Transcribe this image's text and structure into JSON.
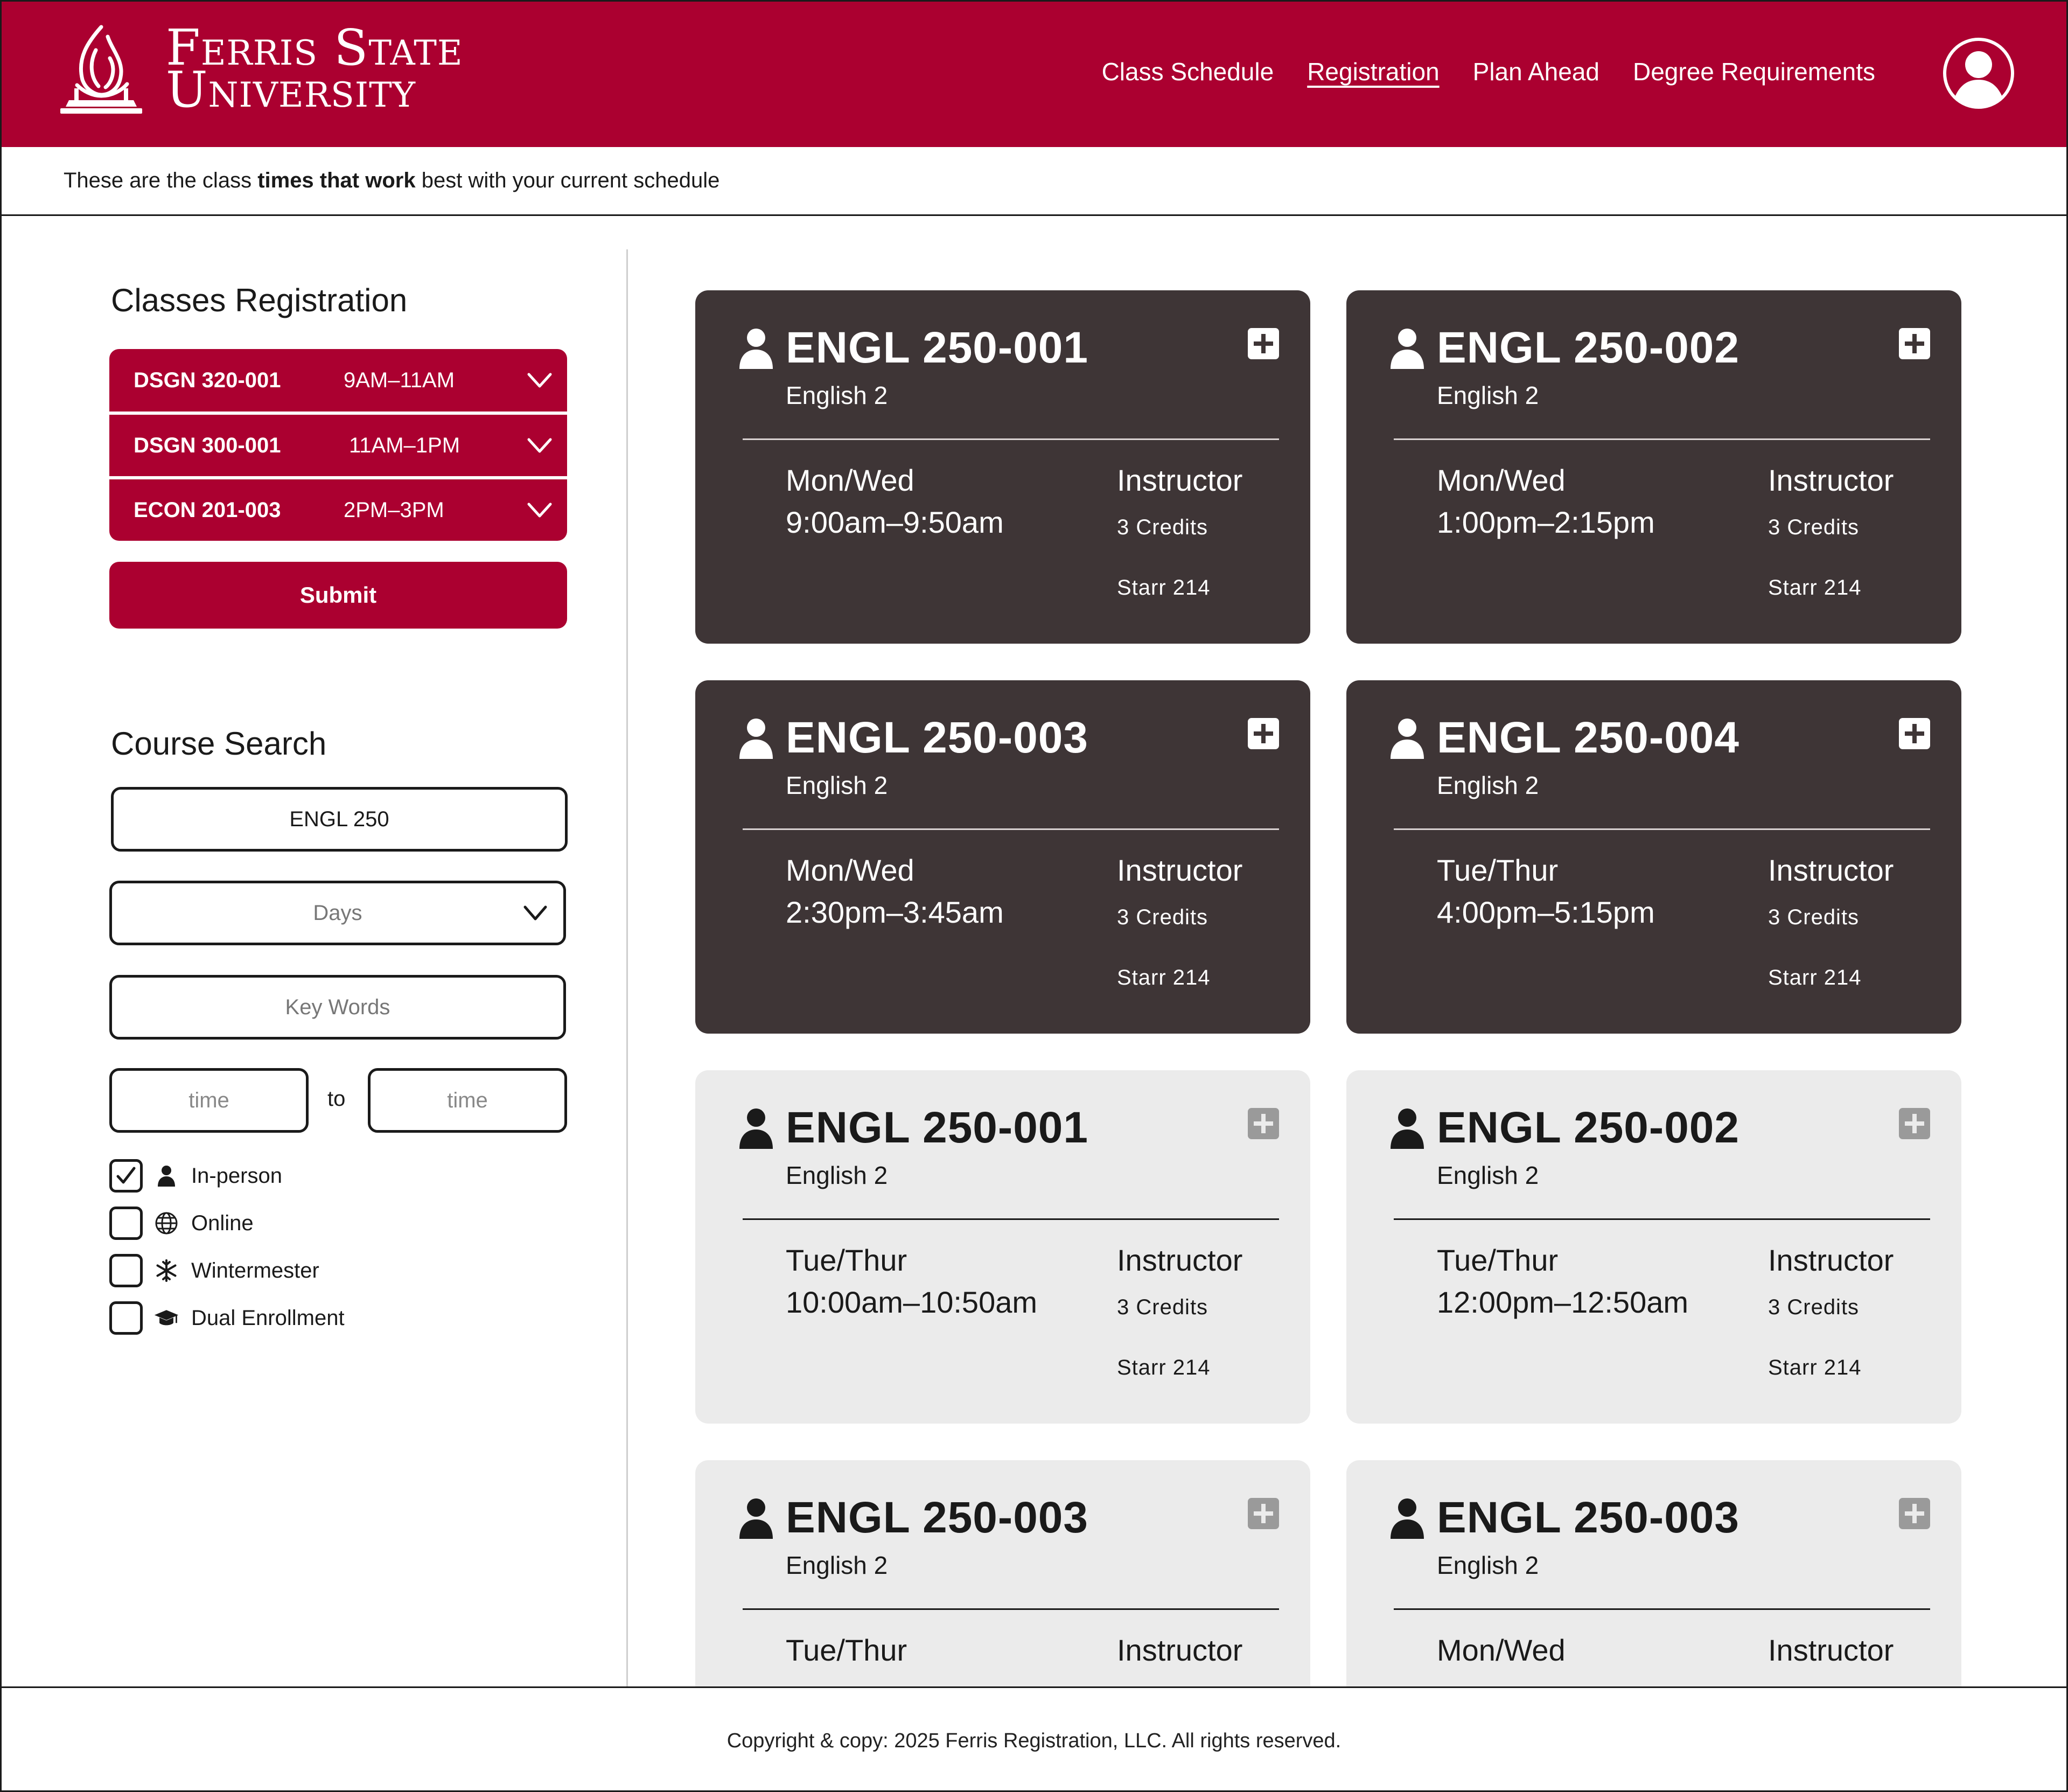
{
  "brand": {
    "line1": "Ferris State",
    "line2": "University",
    "color": "#ab0030"
  },
  "nav": {
    "items": [
      "Class Schedule",
      "Registration",
      "Plan Ahead",
      "Degree Requirements"
    ],
    "active": "Registration"
  },
  "info": {
    "prefix": "These are the class ",
    "emphasis": "times that work",
    "suffix": " best with your current schedule"
  },
  "registration": {
    "title": "Classes Registration",
    "rows": [
      {
        "code": "DSGN 320-001",
        "time": "9AM–11AM"
      },
      {
        "code": "DSGN 300-001",
        "time": "11AM–1PM"
      },
      {
        "code": "ECON 201-003",
        "time": "2PM–3PM"
      }
    ],
    "submit_label": "Submit"
  },
  "search": {
    "title": "Course Search",
    "query_value": "ENGL 250",
    "days_placeholder": "Days",
    "keywords_placeholder": "Key Words",
    "time_from_placeholder": "time",
    "time_to_placeholder": "time",
    "to_label": "to",
    "filters": [
      {
        "label": "In-person",
        "icon": "person-icon",
        "checked": true
      },
      {
        "label": "Online",
        "icon": "globe-icon",
        "checked": false
      },
      {
        "label": "Wintermester",
        "icon": "snowflake-icon",
        "checked": false
      },
      {
        "label": "Dual Enrollment",
        "icon": "graduation-cap-icon",
        "checked": false
      }
    ]
  },
  "cards": [
    {
      "code": "ENGL 250-001",
      "name": "English 2",
      "days": "Mon/Wed",
      "time": "9:00am–9:50am",
      "instructor": "Instructor",
      "credits": "3 Credits",
      "room": "Starr 214",
      "style": "dark"
    },
    {
      "code": "ENGL 250-002",
      "name": "English 2",
      "days": "Mon/Wed",
      "time": "1:00pm–2:15pm",
      "instructor": "Instructor",
      "credits": "3 Credits",
      "room": "Starr 214",
      "style": "dark"
    },
    {
      "code": "ENGL 250-003",
      "name": "English 2",
      "days": "Mon/Wed",
      "time": "2:30pm–3:45am",
      "instructor": "Instructor",
      "credits": "3 Credits",
      "room": "Starr 214",
      "style": "dark"
    },
    {
      "code": "ENGL 250-004",
      "name": "English 2",
      "days": "Tue/Thur",
      "time": "4:00pm–5:15pm",
      "instructor": "Instructor",
      "credits": "3 Credits",
      "room": "Starr 214",
      "style": "dark"
    },
    {
      "code": "ENGL 250-001",
      "name": "English 2",
      "days": "Tue/Thur",
      "time": "10:00am–10:50am",
      "instructor": "Instructor",
      "credits": "3 Credits",
      "room": "Starr 214",
      "style": "light"
    },
    {
      "code": "ENGL 250-002",
      "name": "English 2",
      "days": "Tue/Thur",
      "time": "12:00pm–12:50am",
      "instructor": "Instructor",
      "credits": "3 Credits",
      "room": "Starr 214",
      "style": "light"
    },
    {
      "code": "ENGL 250-003",
      "name": "English 2",
      "days": "Tue/Thur",
      "instructor": "Instructor",
      "style": "light"
    },
    {
      "code": "ENGL 250-003",
      "name": "English 2",
      "days": "Mon/Wed",
      "instructor": "Instructor",
      "style": "light"
    }
  ],
  "footer": {
    "text": "Copyright & copy: 2025 Ferris Registration, LLC. All rights reserved."
  }
}
